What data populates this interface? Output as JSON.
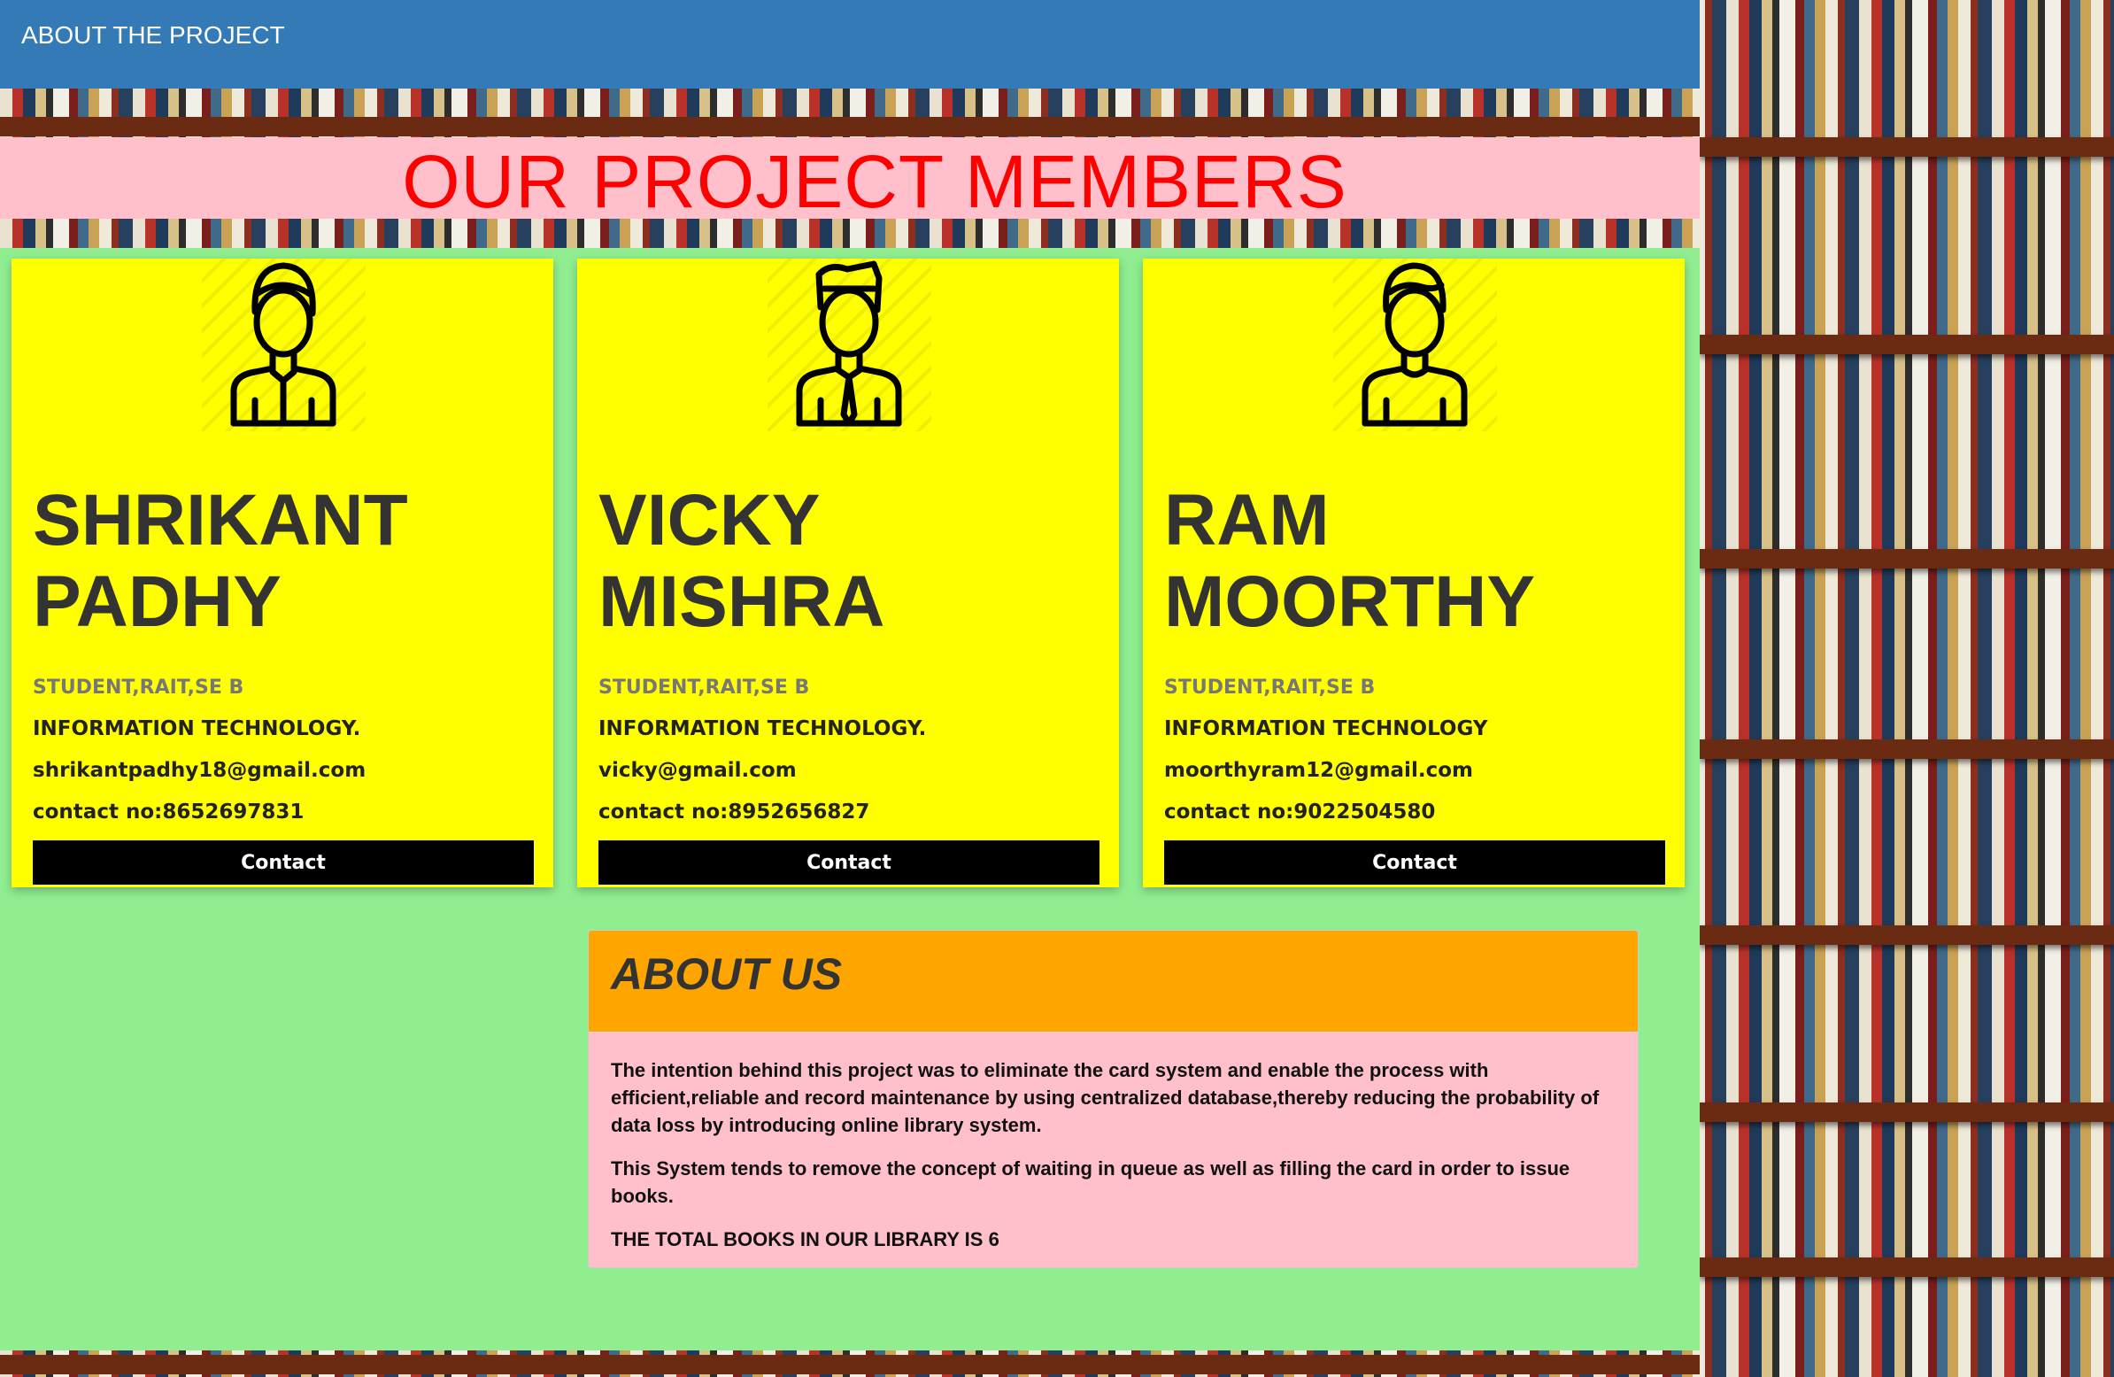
{
  "navbar": {
    "brand": "ABOUT THE PROJECT"
  },
  "banner": {
    "title": "OUR PROJECT MEMBERS"
  },
  "members": [
    {
      "name_line1": "SHRIKANT",
      "name_line2": "PADHY",
      "role": "STUDENT,RAIT,SE B",
      "dept": "INFORMATION TECHNOLOGY.",
      "email": "shrikantpadhy18@gmail.com",
      "phone": "contact no:8652697831",
      "button": "Contact",
      "avatar_icon": "user-avatar-icon"
    },
    {
      "name_line1": "VICKY",
      "name_line2": "MISHRA",
      "role": "STUDENT,RAIT,SE B",
      "dept": "INFORMATION TECHNOLOGY.",
      "email": "vicky@gmail.com",
      "phone": "contact no:8952656827",
      "button": "Contact",
      "avatar_icon": "user-avatar-icon"
    },
    {
      "name_line1": "RAM",
      "name_line2": "MOORTHY",
      "role": "STUDENT,RAIT,SE B",
      "dept": "INFORMATION TECHNOLOGY",
      "email": "moorthyram12@gmail.com",
      "phone": "contact no:9022504580",
      "button": "Contact",
      "avatar_icon": "user-avatar-icon"
    }
  ],
  "about": {
    "heading": "ABOUT US",
    "paragraph1": "The intention behind this project was to eliminate the card system and enable the process with efficient,reliable and record maintenance by using centralized database,thereby reducing the probability of data loss by introducing online library system.",
    "paragraph2": "This System tends to remove the concept of waiting in queue as well as filling the card in order to issue books.",
    "paragraph3": "THE TOTAL BOOKS IN OUR LIBRARY IS 6"
  },
  "colors": {
    "navbar": "#337ab7",
    "banner": "#ffc0cb",
    "title": "#ff0000",
    "main": "#90ee90",
    "card": "#ffff00",
    "about_header": "#ffa500"
  }
}
